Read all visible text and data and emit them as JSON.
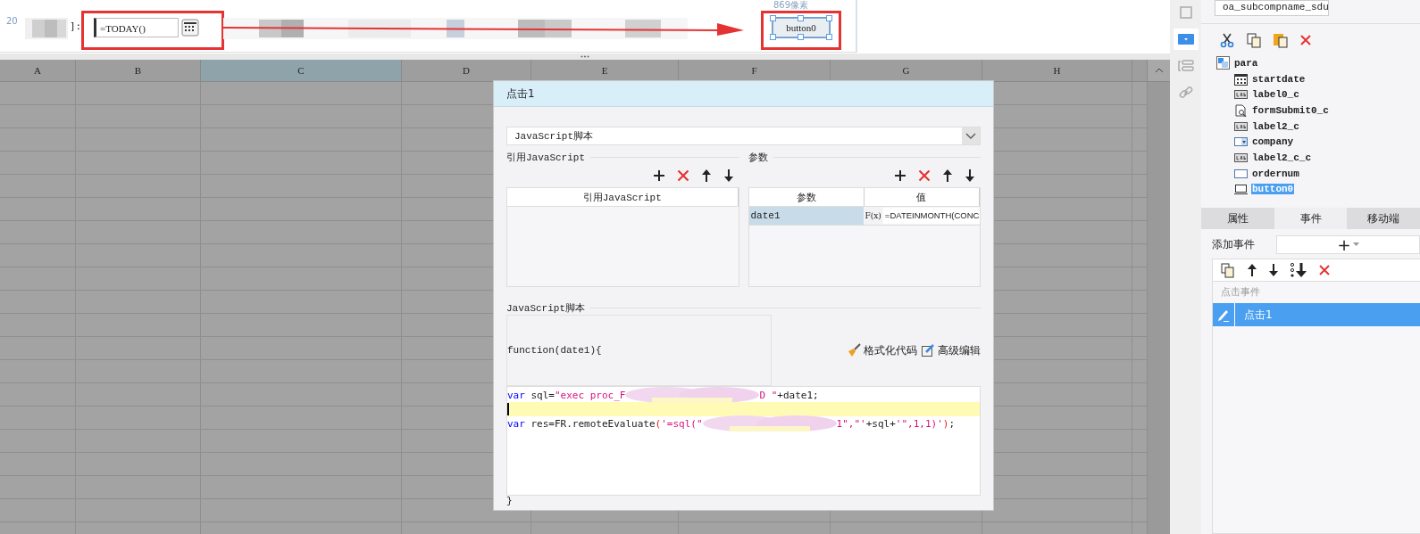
{
  "design_canvas": {
    "label_fragment": "20",
    "label_suffix": "]:",
    "date_field": {
      "value": "=TODAY()"
    },
    "width_hint": "869像素",
    "button": {
      "label": "button0",
      "selected": true
    }
  },
  "sheet": {
    "columns": [
      {
        "label": "A",
        "selected": false
      },
      {
        "label": "B",
        "selected": false
      },
      {
        "label": "C",
        "selected": true
      },
      {
        "label": "D",
        "selected": false
      },
      {
        "label": "E",
        "selected": false
      },
      {
        "label": "F",
        "selected": false
      },
      {
        "label": "G",
        "selected": false
      },
      {
        "label": "H",
        "selected": false
      }
    ]
  },
  "dialog": {
    "title": "点击1",
    "type_select": {
      "value": "JavaScript脚本"
    },
    "ref_js": {
      "legend": "引用JavaScript",
      "column": "引用JavaScript"
    },
    "params": {
      "legend": "参数",
      "columns": [
        "参数",
        "值"
      ],
      "rows": [
        {
          "name": "date1",
          "formula_button": "F(x)",
          "value": "=DATEINMONTH(CONC",
          "selected": true
        }
      ]
    },
    "script": {
      "legend": "JavaScript脚本",
      "signature": "function(date1){",
      "format_button": "格式化代码",
      "advanced_button": "高级编辑",
      "closing": "}",
      "lines": [
        {
          "current": false,
          "tokens": [
            {
              "kind": "keyword",
              "text": "var"
            },
            {
              "kind": "plain",
              "text": " sql="
            },
            {
              "kind": "string",
              "text": "\"exec proc_F"
            },
            {
              "kind": "redacted"
            },
            {
              "kind": "string",
              "text": "D \""
            },
            {
              "kind": "plain",
              "text": "+date1;"
            }
          ]
        },
        {
          "current": true
        },
        {
          "current": false,
          "tokens": [
            {
              "kind": "keyword",
              "text": "var"
            },
            {
              "kind": "plain",
              "text": " res=FR.remoteEvaluate"
            },
            {
              "kind": "bracket",
              "text": "("
            },
            {
              "kind": "string",
              "text": "'=sql(\""
            },
            {
              "kind": "redacted"
            },
            {
              "kind": "string",
              "text": "1\",\"'"
            },
            {
              "kind": "plain",
              "text": "+sql+"
            },
            {
              "kind": "string",
              "text": "'\",1,1)'"
            },
            {
              "kind": "bracket",
              "text": ")"
            },
            {
              "kind": "plain",
              "text": ";"
            }
          ]
        }
      ]
    }
  },
  "side_strip": {
    "tools": [
      {
        "kind": "frame",
        "selected": false
      },
      {
        "kind": "dropdown",
        "selected": true
      },
      {
        "kind": "layout",
        "selected": false
      },
      {
        "kind": "link",
        "selected": false
      }
    ]
  },
  "widget_panel": {
    "name_field": "oa_subcompname_sdu",
    "tree": {
      "label": "para",
      "children": [
        {
          "label": "startdate",
          "kind": "date",
          "selected": false
        },
        {
          "label": "label0_c",
          "kind": "label",
          "selected": false
        },
        {
          "label": "formSubmit0_c",
          "kind": "submit",
          "selected": false
        },
        {
          "label": "label2_c",
          "kind": "label",
          "selected": false
        },
        {
          "label": "company",
          "kind": "combo",
          "selected": false
        },
        {
          "label": "label2_c_c",
          "kind": "label",
          "selected": false
        },
        {
          "label": "ordernum",
          "kind": "text",
          "selected": false
        },
        {
          "label": "button0",
          "kind": "button",
          "selected": true
        }
      ]
    },
    "tabs": [
      {
        "label": "属性",
        "selected": false
      },
      {
        "label": "事件",
        "selected": true
      },
      {
        "label": "移动端",
        "selected": false
      }
    ],
    "add_event_label": "添加事件",
    "add_event_button": "+",
    "events_header": "点击事件",
    "events": [
      {
        "label": "点击1",
        "selected": true
      }
    ]
  }
}
